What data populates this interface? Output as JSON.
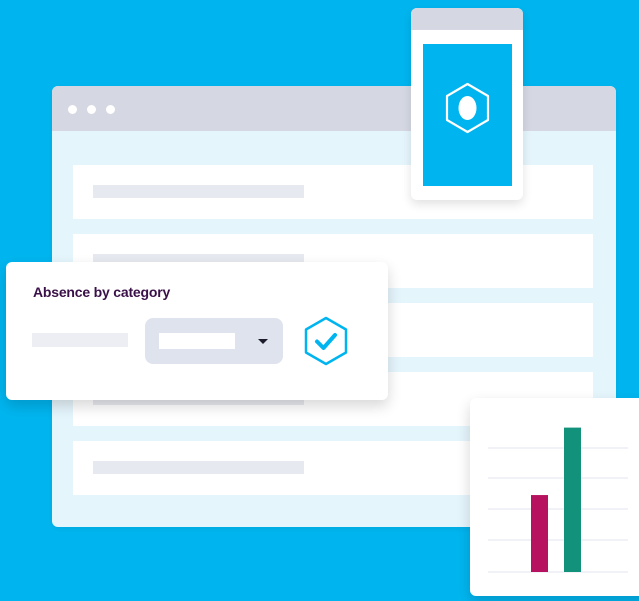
{
  "absence_card": {
    "title": "Absence by category",
    "filter_value": ""
  },
  "chart_data": {
    "type": "bar",
    "categories": [
      "",
      ""
    ],
    "values": [
      81,
      152
    ],
    "ylim": [
      0,
      160
    ],
    "grid": true,
    "series_colors": [
      "#b7125f",
      "#13927b"
    ]
  },
  "colors": {
    "background": "#00b5ef",
    "browser_chrome": "#d5d8e3",
    "browser_body": "#e5f5fc",
    "title_text": "#3a1048",
    "accent": "#00b5ef",
    "bar_magenta": "#b7125f",
    "bar_green": "#13927b"
  },
  "icons": {
    "phone_screen": "hexagon-badge-icon",
    "confirm": "hexagon-check-icon",
    "dropdown": "caret-down-icon"
  }
}
